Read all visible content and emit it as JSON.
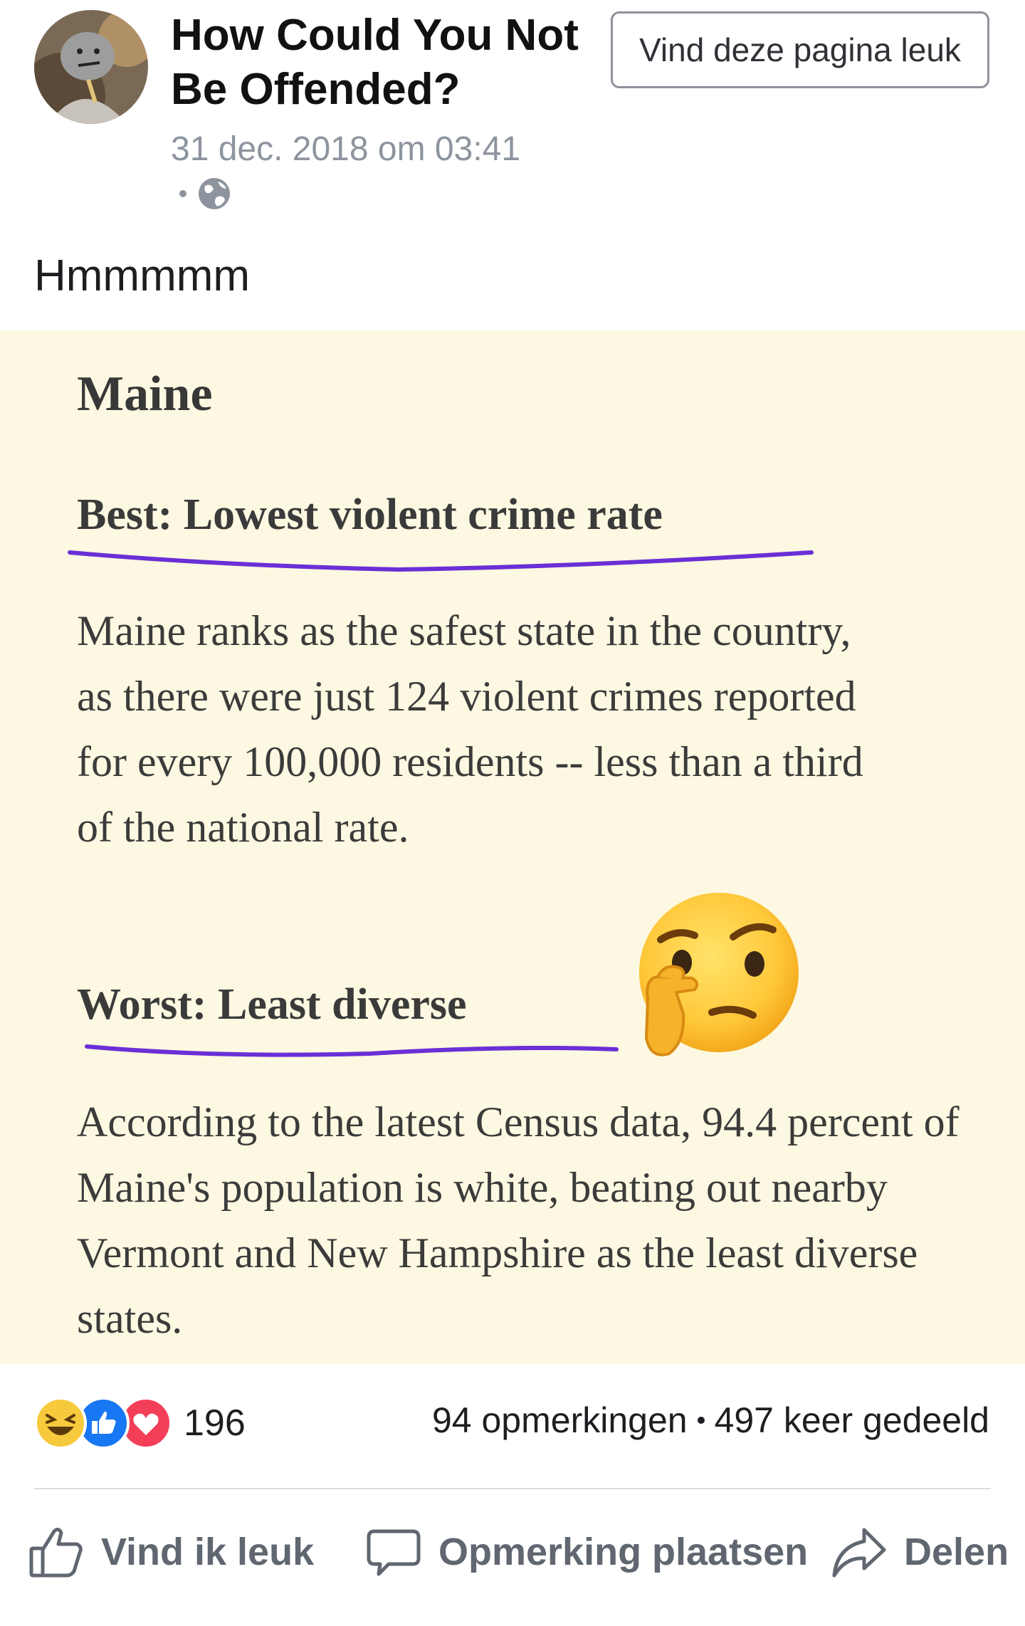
{
  "header": {
    "page_name": "How Could You Not Be Offended?",
    "like_page_button": "Vind deze pagina leuk",
    "timestamp": "31 dec. 2018 om 03:41",
    "privacy_icon": "globe-icon"
  },
  "post": {
    "text": "Hmmmmm"
  },
  "article": {
    "state": "Maine",
    "best_heading": "Best: Lowest violent crime rate",
    "best_text": "Maine ranks as the safest state in the country, as there were just 124 violent crimes reported for every 100,000 residents -- less than a third of the national rate.",
    "worst_heading": "Worst: Least diverse",
    "worst_text": "According to the latest Census data, 94.4 percent of Maine's population is white, beating out nearby Vermont and New Hampshire as the least diverse states.",
    "emoji": "thinking-face-emoji",
    "underline_color": "#6a2fd6",
    "background_color": "#fcf8e1"
  },
  "stats": {
    "reactions": [
      "laughing-reaction",
      "like-reaction",
      "love-reaction"
    ],
    "reaction_count": "196",
    "comments": "94 opmerkingen",
    "shares": "497 keer gedeeld"
  },
  "actions": {
    "like": "Vind ik leuk",
    "comment": "Opmerking plaatsen",
    "share": "Delen"
  }
}
